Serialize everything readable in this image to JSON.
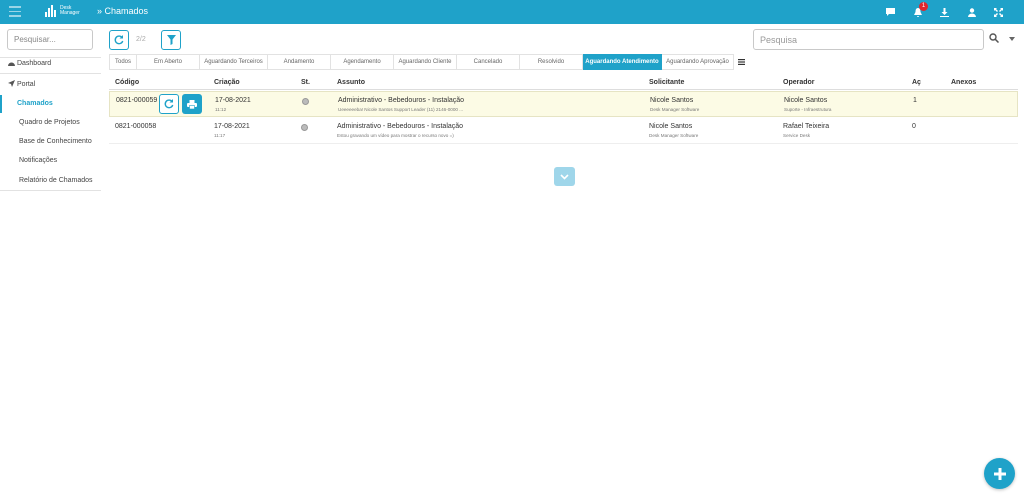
{
  "app": {
    "logo_line1": "Desk",
    "logo_line2": "Manager",
    "page_title": "» Chamados",
    "notification_count": "1"
  },
  "icons": {
    "menu": "hamburger-icon",
    "chat": "chat-icon",
    "alerts": "bell-icon",
    "download": "download-icon",
    "user": "user-icon",
    "fullscreen": "expand-icon"
  },
  "colors": {
    "accent": "#1fa2c9",
    "badge": "#e0262b",
    "highlight_row": "#fcfbe5"
  },
  "sidebar": {
    "search_placeholder": "Pesquisar...",
    "items": [
      {
        "label": "Dashboard"
      },
      {
        "label": "Portal"
      },
      {
        "label": "Chamados"
      },
      {
        "label": "Quadro de Projetos"
      },
      {
        "label": "Base de Conhecimento"
      },
      {
        "label": "Notificações"
      },
      {
        "label": "Relatório de Chamados"
      }
    ]
  },
  "toolbar": {
    "counter": "2/2",
    "search_placeholder": "Pesquisa"
  },
  "tabs": [
    {
      "label": "Todos"
    },
    {
      "label": "Em Aberto"
    },
    {
      "label": "Aguardando Terceiros"
    },
    {
      "label": "Andamento"
    },
    {
      "label": "Agendamento"
    },
    {
      "label": "Aguardando Cliente"
    },
    {
      "label": "Cancelado"
    },
    {
      "label": "Resolvido"
    },
    {
      "label": "Aguardando Atendimento"
    },
    {
      "label": "Aguardando Aprovação"
    }
  ],
  "table": {
    "headers": {
      "codigo": "Código",
      "criacao": "Criação",
      "status": "St.",
      "assunto": "Assunto",
      "solicitante": "Solicitante",
      "operador": "Operador",
      "acoes": "Aç",
      "anexos": "Anexos"
    },
    "rows": [
      {
        "codigo": "0821-000059",
        "data": "17-08-2021",
        "hora": "11:12",
        "assunto": "Administrativo - Bebedouros - Instalação",
        "assunto_sub": "Ueeeeeeba! Nicole Santos Support Leader (11) 2146-0000 ...",
        "solicitante": "Nicole Santos",
        "solicitante_sub": "Desk Manager Software",
        "operador": "Nicole Santos",
        "operador_sub": "Suporte - Infraestrutura",
        "acoes": "1"
      },
      {
        "codigo": "0821-000058",
        "data": "17-08-2021",
        "hora": "11:17",
        "assunto": "Administrativo - Bebedouros - Instalação",
        "assunto_sub": "Estou gravando um vídeo para mostrar o recurso novo =)",
        "solicitante": "Nicole Santos",
        "solicitante_sub": "Desk Manager Software",
        "operador": "Rafael Teixeira",
        "operador_sub": "Service Desk",
        "acoes": "0"
      }
    ]
  }
}
